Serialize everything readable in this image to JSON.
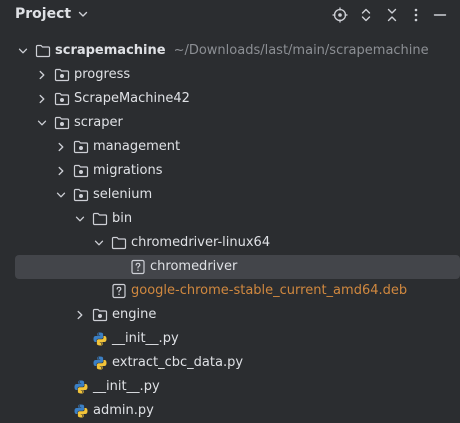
{
  "header": {
    "title": "Project",
    "icons": [
      "locate-icon",
      "expand-all-icon",
      "collapse-all-icon",
      "more-options-icon",
      "minimize-icon"
    ]
  },
  "tree": {
    "root": {
      "label": "scrapemachine",
      "path": "~/Downloads/last/main/scrapemachine"
    },
    "progress": {
      "label": "progress"
    },
    "scrapemachine42": {
      "label": "ScrapeMachine42"
    },
    "scraper": {
      "label": "scraper"
    },
    "management": {
      "label": "management"
    },
    "migrations": {
      "label": "migrations"
    },
    "selenium": {
      "label": "selenium"
    },
    "bin": {
      "label": "bin"
    },
    "chromedriver_linux64": {
      "label": "chromedriver-linux64"
    },
    "chromedriver": {
      "label": "chromedriver"
    },
    "deb": {
      "label": "google-chrome-stable_current_amd64.deb"
    },
    "engine": {
      "label": "engine"
    },
    "init_selenium": {
      "label": "__init__.py"
    },
    "extract": {
      "label": "extract_cbc_data.py"
    },
    "init_scraper": {
      "label": "__init__.py"
    },
    "admin": {
      "label": "admin.py"
    }
  },
  "colors": {
    "background": "#2b2d30",
    "selected_row": "#43454a",
    "text": "#dfe1e5",
    "muted": "#8c8f94",
    "ignored_file": "#d0883f"
  }
}
